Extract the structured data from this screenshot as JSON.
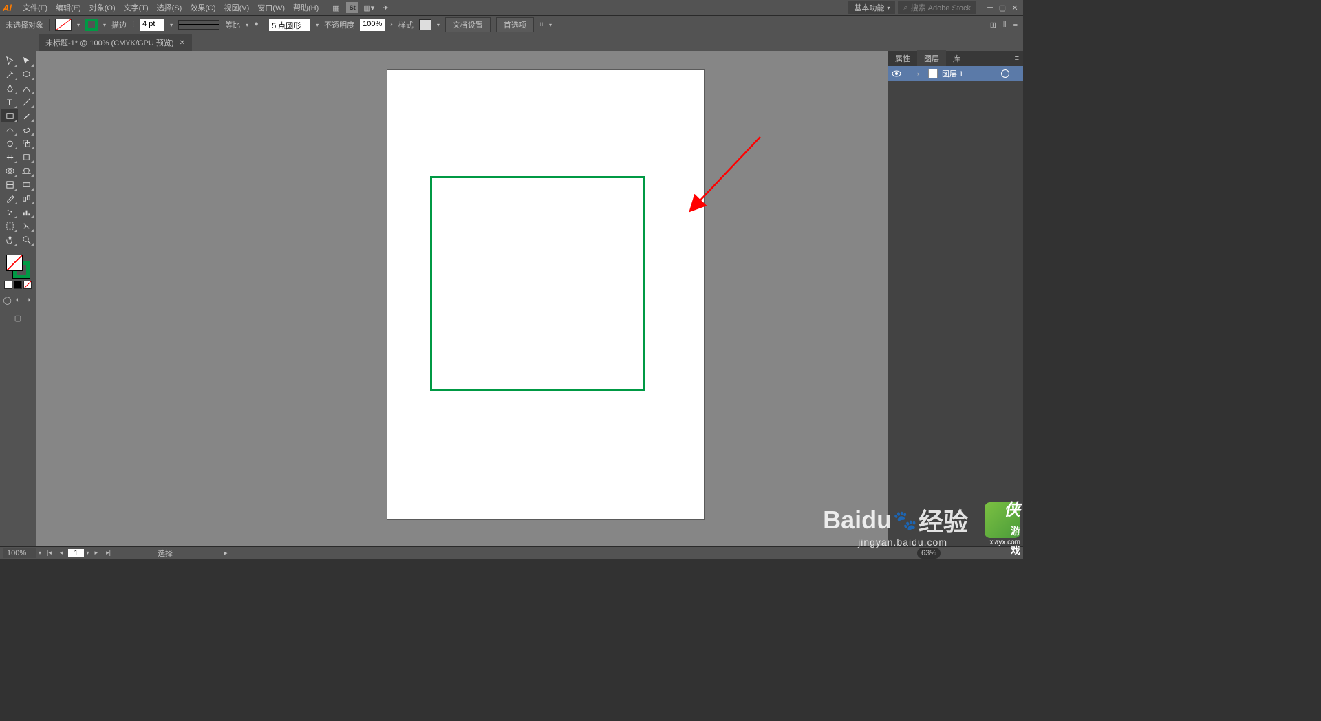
{
  "menubar": {
    "logo": "Ai",
    "items": [
      "文件(F)",
      "编辑(E)",
      "对象(O)",
      "文字(T)",
      "选择(S)",
      "效果(C)",
      "视图(V)",
      "窗口(W)",
      "帮助(H)"
    ],
    "workspace": "基本功能",
    "search_placeholder": "搜索 Adobe Stock"
  },
  "options": {
    "selection_status": "未选择对象",
    "stroke_label": "描边",
    "stroke_weight": "4 pt",
    "stroke_type": "等比",
    "dash_value": "5 点圆形",
    "opacity_label": "不透明度",
    "opacity_value": "100%",
    "style_label": "样式",
    "doc_setup": "文档设置",
    "prefs": "首选项"
  },
  "document": {
    "tab_title": "未标题-1* @ 100% (CMYK/GPU 预览)"
  },
  "panels": {
    "tabs": [
      "属性",
      "图层",
      "库"
    ],
    "active_tab": 1,
    "layer_name": "图层 1"
  },
  "status": {
    "zoom": "100%",
    "artboard_num": "1",
    "tool_name": "选择"
  },
  "colors": {
    "stroke": "#009944",
    "accent_layer": "#5b7aa8"
  },
  "watermark": {
    "baidu": "Baidu",
    "jingyan": "经验",
    "url": "jingyan.baidu.com",
    "xia_url": "xiayx.com",
    "xia_brand": "侠",
    "xia_sub": "游戏",
    "scale": "63%"
  }
}
